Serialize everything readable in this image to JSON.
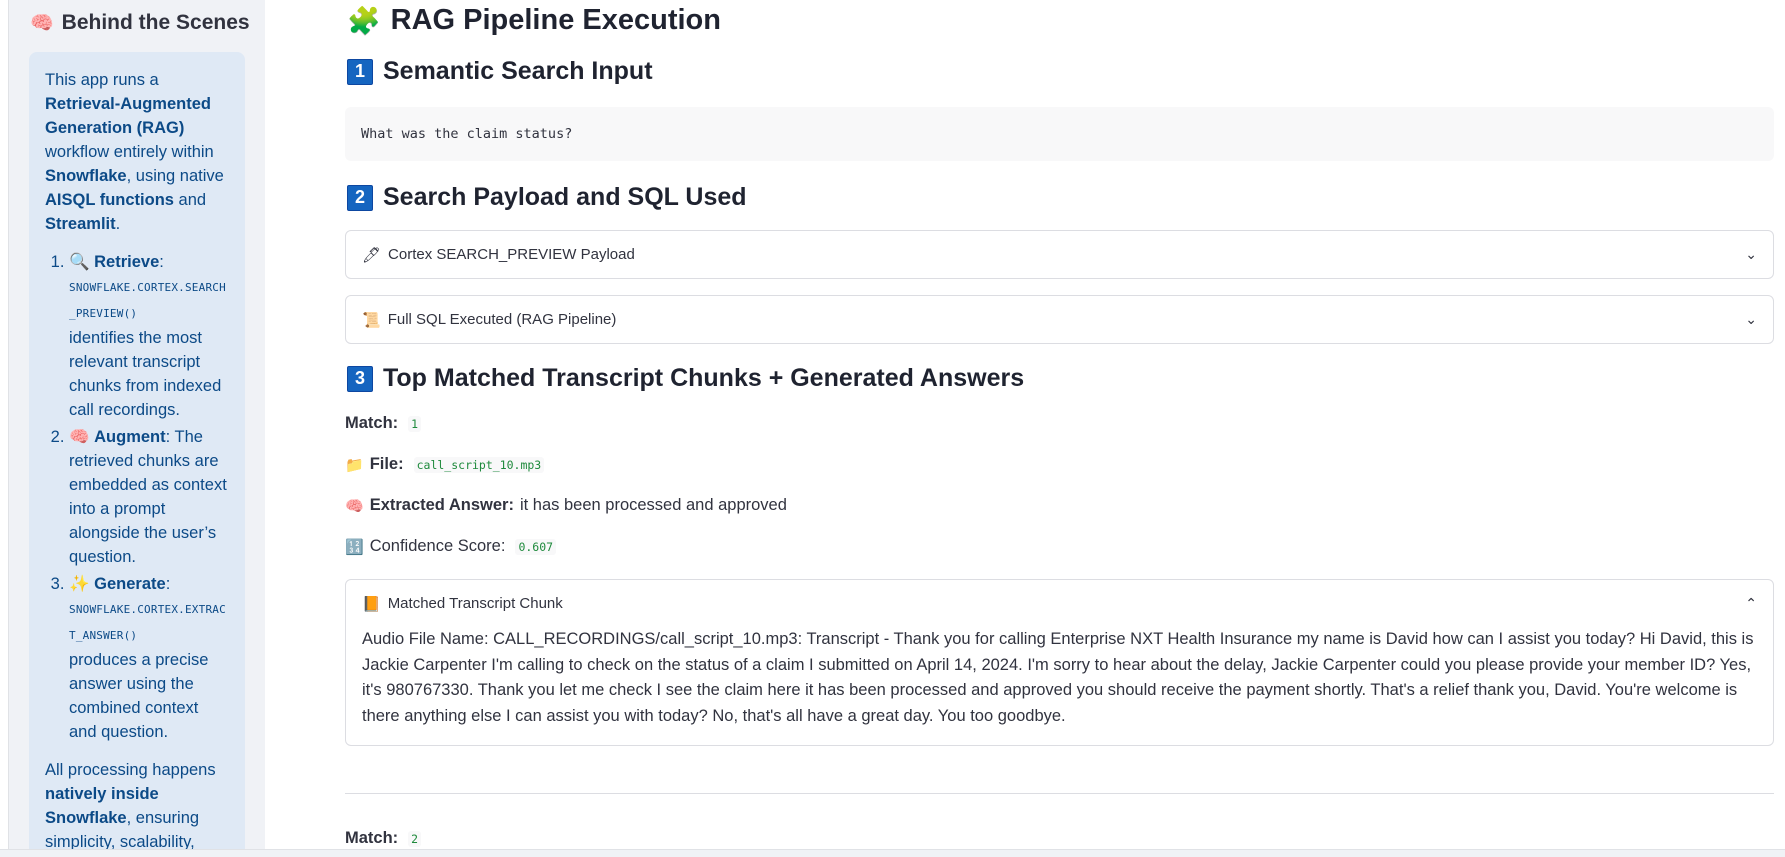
{
  "sidebar": {
    "title": "Behind the Scenes",
    "title_icon": "🧠",
    "intro": {
      "t1": "This app runs a ",
      "b1": "Retrieval-Augmented Generation (RAG)",
      "t2": " workflow entirely within ",
      "b2": "Snowflake",
      "t3": ", using native ",
      "b3": "AISQL functions",
      "t4": " and ",
      "b4": "Streamlit",
      "t5": "."
    },
    "steps": [
      {
        "icon": "🔍",
        "name": "Retrieve",
        "sep": ":",
        "code": "SNOWFLAKE.CORTEX.SEARCH_PREVIEW()",
        "text": "identifies the most relevant transcript chunks from indexed call recordings."
      },
      {
        "icon": "🧠",
        "name": "Augment",
        "sep": ":",
        "code": "",
        "text": "The retrieved chunks are embedded as context into a prompt alongside the user’s question."
      },
      {
        "icon": "✨",
        "name": "Generate",
        "sep": ":",
        "code": "SNOWFLAKE.CORTEX.EXTRACT_ANSWER()",
        "text": "produces a precise answer using the combined context and question."
      }
    ],
    "closing": {
      "t1": "All processing happens ",
      "b1": "natively inside Snowflake",
      "t2": ", ensuring simplicity, scalability,"
    }
  },
  "main": {
    "title": "RAG Pipeline Execution",
    "title_icon": "🧩",
    "sections": [
      {
        "num": "1",
        "title": "Semantic Search Input"
      },
      {
        "num": "2",
        "title": "Search Payload and SQL Used"
      },
      {
        "num": "3",
        "title": "Top Matched Transcript Chunks + Generated Answers"
      }
    ],
    "query": "What was the claim status?",
    "expanders": [
      {
        "icon": "🖊",
        "label": "Cortex SEARCH_PREVIEW Payload",
        "state": "collapsed"
      },
      {
        "icon": "📜",
        "label": "Full SQL Executed (RAG Pipeline)",
        "state": "collapsed"
      }
    ],
    "match1": {
      "match_label": "Match:",
      "match_value": "1",
      "file_icon": "📁",
      "file_label": "File:",
      "file_value": "call_script_10.mp3",
      "answer_icon": "🧠",
      "answer_label": "Extracted Answer:",
      "answer_value": "it has been processed and approved",
      "score_icon": "🔢",
      "score_label": "Confidence Score:",
      "score_value": "0.607",
      "chunk_icon": "📙",
      "chunk_label": "Matched Transcript Chunk",
      "chunk_text": "Audio File Name: CALL_RECORDINGS/call_script_10.mp3: Transcript - Thank you for calling Enterprise NXT Health Insurance my name is David how can I assist you today? Hi David, this is Jackie Carpenter I'm calling to check on the status of a claim I submitted on April 14, 2024. I'm sorry to hear about the delay, Jackie Carpenter could you please provide your member ID? Yes, it's 980767330. Thank you let me check I see the claim here it has been processed and approved you should receive the payment shortly. That's a relief thank you, David. You're welcome is there anything else I can assist you with today? No, that's all have a great day. You too goodbye."
    },
    "match2": {
      "match_label": "Match:",
      "match_value": "2"
    }
  },
  "colors": {
    "sidebar_bg": "#f0f2f6",
    "info_bg": "#dfe9f5",
    "info_text": "#0c4a87",
    "number_badge": "#1565c0",
    "code_green": "#1e8a3c"
  }
}
